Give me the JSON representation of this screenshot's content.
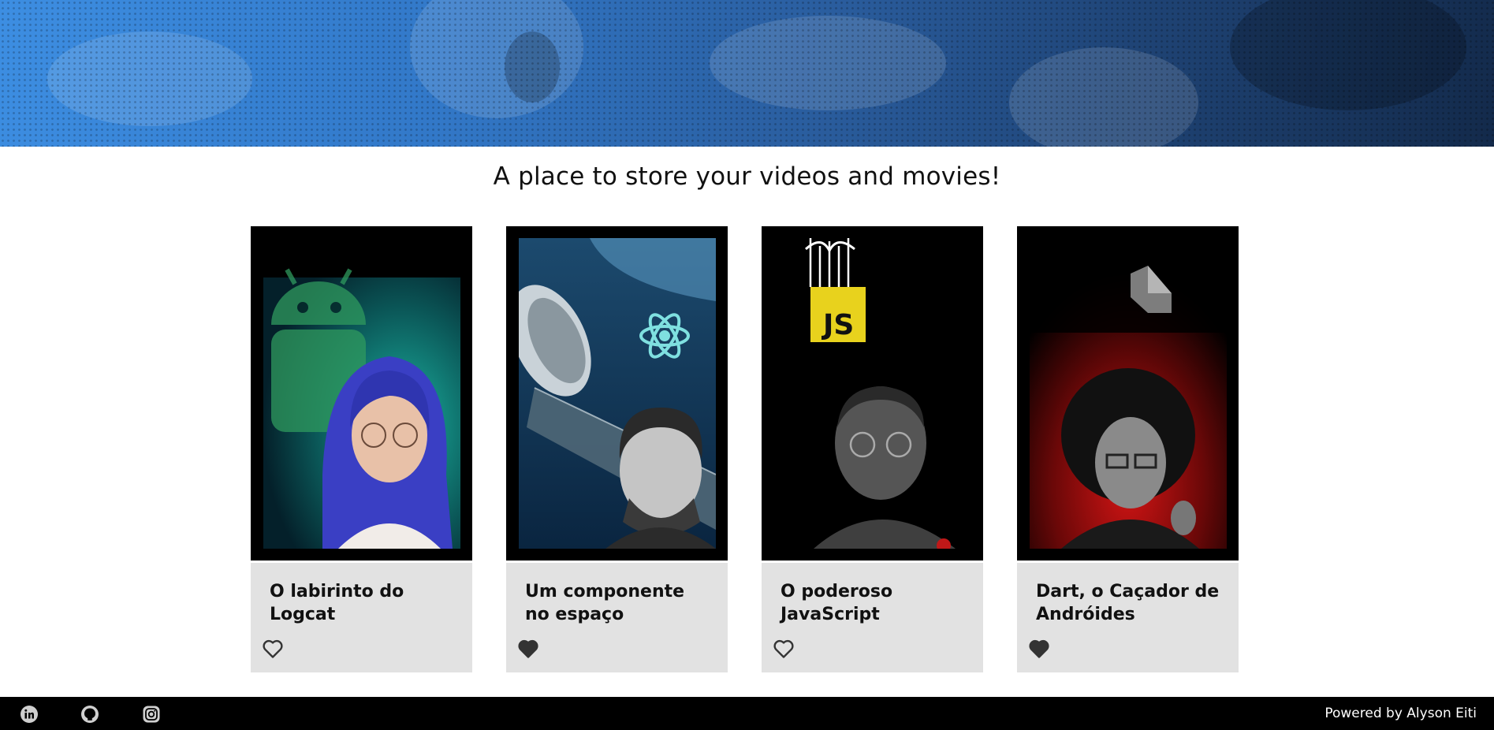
{
  "subtitle": "A place to store your videos and movies!",
  "cards": [
    {
      "title": "O labirinto do Logcat",
      "favorited": false,
      "poster_icon": "android-robot-icon"
    },
    {
      "title": "Um componente no espaço",
      "favorited": true,
      "poster_icon": "react-atom-icon"
    },
    {
      "title": "O poderoso JavaScript",
      "favorited": false,
      "poster_icon": "javascript-logo-icon"
    },
    {
      "title": "Dart, o Caçador de Andróides",
      "favorited": true,
      "poster_icon": "dart-logo-icon"
    }
  ],
  "footer": {
    "social": [
      "linkedin-icon",
      "github-icon",
      "instagram-icon"
    ],
    "powered_by": "Powered by Alyson Eiti"
  },
  "colors": {
    "hero_blue": "#3d8ee2",
    "card_info_bg": "#e2e2e2",
    "footer_bg": "#000000",
    "heart": "#333333"
  }
}
